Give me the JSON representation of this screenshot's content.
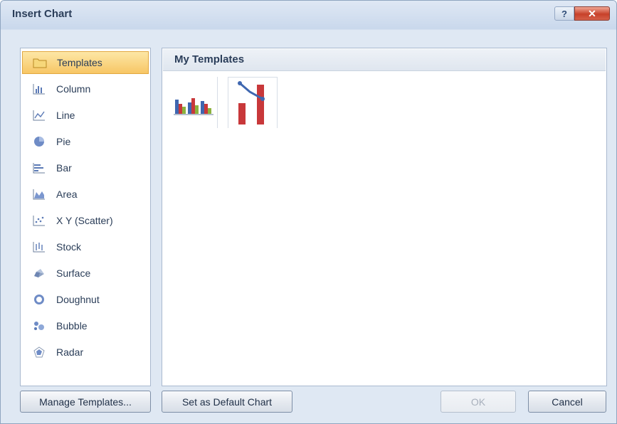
{
  "window": {
    "title": "Insert Chart",
    "help_label": "?",
    "close_label": "✕"
  },
  "categories": [
    {
      "label": "Templates",
      "icon": "folder-icon",
      "selected": true
    },
    {
      "label": "Column",
      "icon": "column-chart-icon"
    },
    {
      "label": "Line",
      "icon": "line-chart-icon"
    },
    {
      "label": "Pie",
      "icon": "pie-chart-icon"
    },
    {
      "label": "Bar",
      "icon": "bar-chart-icon"
    },
    {
      "label": "Area",
      "icon": "area-chart-icon"
    },
    {
      "label": "X Y (Scatter)",
      "icon": "scatter-chart-icon"
    },
    {
      "label": "Stock",
      "icon": "stock-chart-icon"
    },
    {
      "label": "Surface",
      "icon": "surface-chart-icon"
    },
    {
      "label": "Doughnut",
      "icon": "doughnut-chart-icon"
    },
    {
      "label": "Bubble",
      "icon": "bubble-chart-icon"
    },
    {
      "label": "Radar",
      "icon": "radar-chart-icon"
    }
  ],
  "main": {
    "section_title": "My Templates",
    "templates": [
      {
        "icon": "clustered-column-template-icon"
      },
      {
        "icon": "line-column-combo-template-icon"
      }
    ]
  },
  "buttons": {
    "manage_templates": "Manage Templates...",
    "set_default": "Set as Default Chart",
    "ok": "OK",
    "cancel": "Cancel"
  },
  "colors": {
    "selection": "#f7c665",
    "accent_red": "#c8383a",
    "accent_blue": "#3f67b0"
  }
}
